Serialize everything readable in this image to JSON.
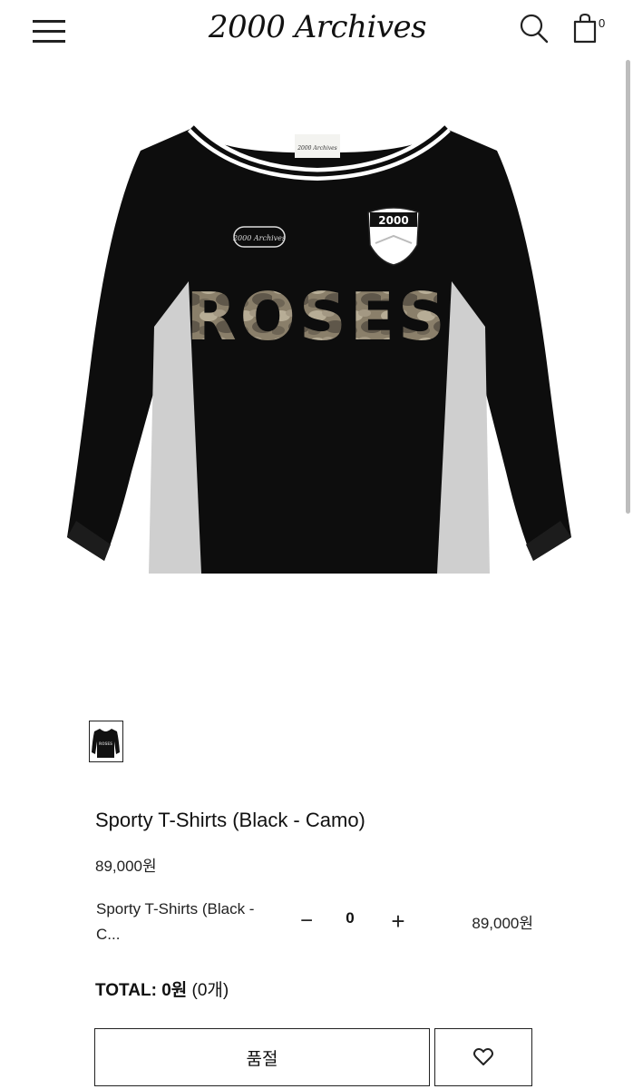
{
  "header": {
    "logo": "2000 Archives",
    "cart_count": "0"
  },
  "icons": {
    "menu": "hamburger-menu-icon",
    "search": "search-icon",
    "cart": "shopping-bag-icon",
    "wishlist": "heart-icon"
  },
  "product": {
    "image_text": {
      "chest_print": "ROSES",
      "badge_text": "2000",
      "patch_text": "2000 Archives",
      "label_text": "2000 Archives"
    },
    "title": "Sporty T-Shirts (Black - Camo)",
    "price": "89,000원"
  },
  "option": {
    "name": "Sporty T-Shirts (Black - C...",
    "minus": "−",
    "quantity": "0",
    "plus": "+",
    "price": "89,000원"
  },
  "total": {
    "label": "TOTAL:",
    "amount": "0원",
    "count": "(0개)"
  },
  "actions": {
    "soldout_label": "품절"
  },
  "colors": {
    "text": "#111111",
    "garment": "#0d0d0d",
    "side_panel": "#cfcfcf"
  }
}
